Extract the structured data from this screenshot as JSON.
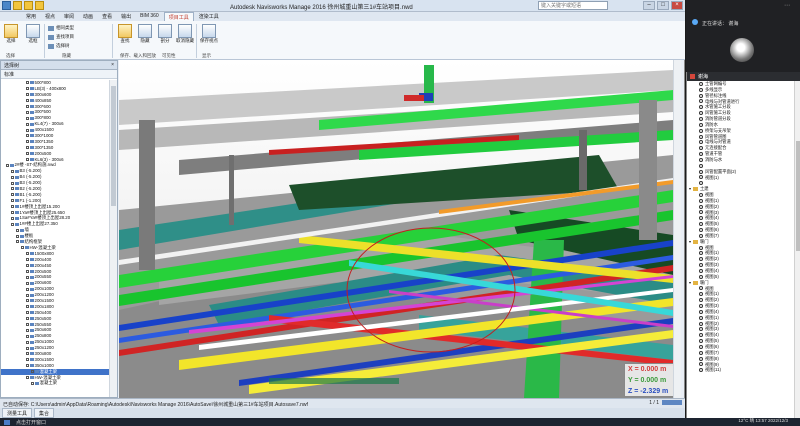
{
  "window": {
    "title": "Autodesk Navisworks Manage 2016    徐州城重山第三1#车站项目.nwd",
    "search_placeholder": "键入关键字或短语"
  },
  "ribbon": {
    "tabs": [
      "常用",
      "视点",
      "审阅",
      "动画",
      "查看",
      "输出",
      "BIM 360",
      "项目工具",
      "渲染工具"
    ],
    "active_tab": "项目工具",
    "buttons": {
      "select": "选择",
      "box": "选框",
      "find": "查找",
      "hide": "隐藏",
      "sections": "剖分",
      "unhide": "取消隐藏",
      "camera": "保存视点"
    },
    "options": {
      "same_type": "相同类型",
      "find_item": "查找项目",
      "selection_tree": "选择树",
      "properties": "特性"
    },
    "groups": [
      "选择",
      "隐藏",
      "保存、载入和回放",
      "可见性",
      "显示"
    ]
  },
  "tree": {
    "title": "选择树",
    "close": "×",
    "filter": "标准",
    "rows": [
      {
        "t": "500*800",
        "d": 5
      },
      {
        "t": "LB(3) - 400x800",
        "d": 5
      },
      {
        "t": "300x600",
        "d": 5
      },
      {
        "t": "400x850",
        "d": 5
      },
      {
        "t": "300*600",
        "d": 5
      },
      {
        "t": "300*500",
        "d": 5
      },
      {
        "t": "300*800",
        "d": 5
      },
      {
        "t": "KL4(7) - 300x6",
        "d": 5
      },
      {
        "t": "400x1500",
        "d": 5
      },
      {
        "t": "300*1000",
        "d": 5
      },
      {
        "t": "300*1350",
        "d": 5
      },
      {
        "t": "300*1350",
        "d": 5
      },
      {
        "t": "200x500",
        "d": 5
      },
      {
        "t": "KL6(3) - 300x6",
        "d": 5
      },
      {
        "t": "2#楼 -ST-结构施.nwd",
        "d": 1
      },
      {
        "t": "B3 (-5.200)",
        "d": 2
      },
      {
        "t": "B4 (-5.200)",
        "d": 2
      },
      {
        "t": "B3 (-5.200)",
        "d": 2
      },
      {
        "t": "B2 (-5.200)",
        "d": 2
      },
      {
        "t": "B1 (-5.200)",
        "d": 2
      },
      {
        "t": "F1 (-1.200)",
        "d": 2
      },
      {
        "t": "1#楼顶上出屋15.200",
        "d": 2
      },
      {
        "t": "1Ya#楼顶上出屋25.650",
        "d": 2
      },
      {
        "t": "1Sa#Ya#楼顶上出屋28.20",
        "d": 2
      },
      {
        "t": "1##楼上出屋27.350",
        "d": 2
      },
      {
        "t": "墙",
        "d": 3
      },
      {
        "t": "楼板",
        "d": 3
      },
      {
        "t": "结构框架",
        "d": 3
      },
      {
        "t": "HW-混凝土梁",
        "d": 4
      },
      {
        "t": "1500x800",
        "d": 5
      },
      {
        "t": "200x400",
        "d": 5
      },
      {
        "t": "200x450",
        "d": 5
      },
      {
        "t": "200x500",
        "d": 5
      },
      {
        "t": "200x550",
        "d": 5
      },
      {
        "t": "200x600",
        "d": 5
      },
      {
        "t": "200x1000",
        "d": 5
      },
      {
        "t": "200x1200",
        "d": 5
      },
      {
        "t": "200x1500",
        "d": 5
      },
      {
        "t": "200x1800",
        "d": 5
      },
      {
        "t": "250x400",
        "d": 5
      },
      {
        "t": "250x500",
        "d": 5
      },
      {
        "t": "250x550",
        "d": 5
      },
      {
        "t": "250x600",
        "d": 5
      },
      {
        "t": "250x800",
        "d": 5
      },
      {
        "t": "250x1000",
        "d": 5
      },
      {
        "t": "250x1200",
        "d": 5
      },
      {
        "t": "300x800",
        "d": 5
      },
      {
        "t": "300x1500",
        "d": 5
      },
      {
        "t": "350x1000",
        "d": 5
      },
      {
        "t": "混凝土梁",
        "d": 6,
        "sel": true
      },
      {
        "t": "HW-混凝土梁",
        "d": 5
      },
      {
        "t": "混凝土梁",
        "d": 6
      }
    ]
  },
  "viewport": {
    "coords": {
      "x": "X = 0.000 m",
      "y": "Y = 0.000 m",
      "z": "Z = -2.329 m"
    },
    "colors": {
      "coord_x": "#d23c3c",
      "coord_y": "#3a9a3a",
      "coord_z": "#2a4fc0"
    }
  },
  "status": {
    "text": "已自动保存: C:\\Users\\admin\\AppData\\Roaming\\Autodesk\\Navisworks Manage 2016\\AutoSave\\徐州城重山第三1#车站项目.Autosave7.nwf",
    "page": "1 / 1"
  },
  "bottom_tabs": [
    "测量工具",
    "集合"
  ],
  "taskbar": {
    "label": "点击打开窗口",
    "clock_time": "13:57",
    "clock_date": "2022/12/3",
    "weather": "12°C  晴"
  },
  "meeting": {
    "speaking_label": "正在讲话：",
    "speaker": "谢海"
  },
  "outline": {
    "title": "谢海",
    "rows": [
      {
        "t": "土管网编号",
        "k": "c"
      },
      {
        "t": "多线显示",
        "k": "c"
      },
      {
        "t": "管径标注线",
        "k": "c"
      },
      {
        "t": "电线与对管道进行",
        "k": "c"
      },
      {
        "t": "水管施工分段",
        "k": "c"
      },
      {
        "t": "风管施工分段",
        "k": "c"
      },
      {
        "t": "消防管道分段",
        "k": "c"
      },
      {
        "t": "消防水",
        "k": "c"
      },
      {
        "t": "桥架与支吊架",
        "k": "c"
      },
      {
        "t": "风管管道图",
        "k": "c"
      },
      {
        "t": "电线与对管道",
        "k": "c"
      },
      {
        "t": "元连接配合",
        "k": "c"
      },
      {
        "t": "管道干管",
        "k": "c"
      },
      {
        "t": "消防与水",
        "k": "c"
      },
      {
        "t": "",
        "k": "c"
      },
      {
        "t": "风管配置平面(2)",
        "k": "c"
      },
      {
        "t": "视图(1)",
        "k": "c"
      },
      {
        "t": "",
        "k": "c"
      },
      {
        "t": "土建",
        "k": "f"
      },
      {
        "t": "视图",
        "k": "c"
      },
      {
        "t": "视图(1)",
        "k": "c"
      },
      {
        "t": "视图(2)",
        "k": "c"
      },
      {
        "t": "视图(3)",
        "k": "c"
      },
      {
        "t": "视图(4)",
        "k": "c"
      },
      {
        "t": "视图(5)",
        "k": "c"
      },
      {
        "t": "视图(6)",
        "k": "c"
      },
      {
        "t": "视图(7)",
        "k": "c"
      },
      {
        "t": "暖门",
        "k": "f"
      },
      {
        "t": "视图",
        "k": "c"
      },
      {
        "t": "视图(1)",
        "k": "c"
      },
      {
        "t": "视图(2)",
        "k": "c"
      },
      {
        "t": "视图(3)",
        "k": "c"
      },
      {
        "t": "视图(4)",
        "k": "c"
      },
      {
        "t": "视图(5)",
        "k": "c"
      },
      {
        "t": "暖门",
        "k": "f"
      },
      {
        "t": "视图",
        "k": "c"
      },
      {
        "t": "视图(1)",
        "k": "c"
      },
      {
        "t": "视图(2)",
        "k": "c"
      },
      {
        "t": "视图(3)",
        "k": "c"
      },
      {
        "t": "视图(4)",
        "k": "c"
      },
      {
        "t": "视图(1)",
        "k": "c"
      },
      {
        "t": "视图(2)",
        "k": "c"
      },
      {
        "t": "视图(3)",
        "k": "c"
      },
      {
        "t": "视图(4)",
        "k": "c"
      },
      {
        "t": "视图(5)",
        "k": "c"
      },
      {
        "t": "视图(6)",
        "k": "c"
      },
      {
        "t": "视图(7)",
        "k": "c"
      },
      {
        "t": "视图(8)",
        "k": "c"
      },
      {
        "t": "视图(9)",
        "k": "c"
      },
      {
        "t": "视图(11)",
        "k": "c"
      }
    ]
  }
}
